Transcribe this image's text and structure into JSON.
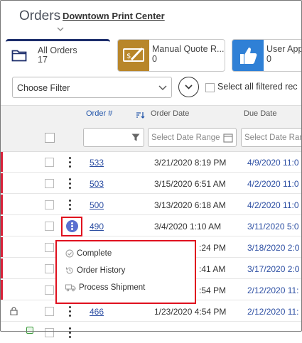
{
  "header": {
    "title": "Orders",
    "org": "Downtown Print Center"
  },
  "tabs": [
    {
      "label": "All Orders",
      "count": "17"
    },
    {
      "label": "Manual Quote R...",
      "count": "0"
    },
    {
      "label": "User App",
      "count": "0"
    }
  ],
  "filter": {
    "value": "Choose Filter",
    "select_all_label": "Select all filtered rec"
  },
  "columns": {
    "order": "Order #",
    "order_date": "Order Date",
    "due_date": "Due Date"
  },
  "filters": {
    "date_placeholder": "Select Date Range",
    "due_placeholder": "Select Date Rang"
  },
  "rows": [
    {
      "order": "533",
      "order_date": "3/21/2020 8:19 PM",
      "due_date": "4/9/2020 11:0"
    },
    {
      "order": "503",
      "order_date": "3/15/2020 6:51 AM",
      "due_date": "4/2/2020 11:0"
    },
    {
      "order": "500",
      "order_date": "3/13/2020 6:18 AM",
      "due_date": "4/2/2020 11:0"
    },
    {
      "order": "490",
      "order_date": "3/4/2020 1:10 AM",
      "due_date": "3/11/2020 5:0"
    },
    {
      "order": "",
      "order_date": ":24 PM",
      "due_date": "3/18/2020 2:0"
    },
    {
      "order": "",
      "order_date": ":41 AM",
      "due_date": "3/17/2020 2:0"
    },
    {
      "order": "",
      "order_date": ":54 PM",
      "due_date": "2/12/2020 11:"
    },
    {
      "order": "466",
      "order_date": "1/23/2020 4:54 PM",
      "due_date": "2/12/2020 11:"
    }
  ],
  "menu": {
    "items": [
      "Complete",
      "Order History",
      "Process Shipment"
    ]
  },
  "colors": {
    "accent": "#2d4fa3",
    "flag": "#d9223a",
    "highlight": "#e0101e",
    "quote_tab": "#b8862a",
    "user_tab": "#2f80d6",
    "tab_border": "#1c2d6b"
  }
}
